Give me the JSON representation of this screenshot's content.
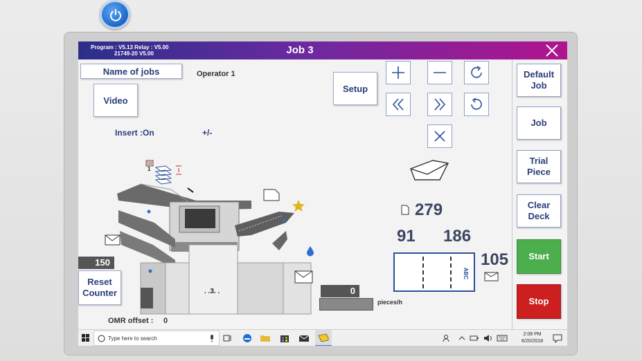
{
  "header": {
    "program_line": "Program : V5.13   Relay : V5.00",
    "serial_line": "21749-20 V5.00",
    "title": "Job 3"
  },
  "controls": {
    "name_of_jobs": "Name of jobs",
    "operator": "Operator 1",
    "video": "Video",
    "setup": "Setup",
    "insert": "Insert :On",
    "plus_minus": "+/-",
    "reset_counter": "Reset Counter",
    "omr_offset_label": "OMR offset :",
    "omr_offset_value": "0",
    "counter_value": "150",
    "machine_dots": ". .3. .",
    "bin_count": "1"
  },
  "stats": {
    "sheets": "279",
    "left_count": "91",
    "right_count": "186",
    "envelope_count": "105",
    "pieces_value": "0",
    "pieces_label": "pieces/h",
    "envelope_text": "ABC"
  },
  "sidebar": {
    "default_job": "Default Job",
    "job": "Job",
    "trial_piece": "Trial Piece",
    "clear_deck": "Clear Deck",
    "start": "Start",
    "stop": "Stop"
  },
  "taskbar": {
    "search_placeholder": "Type here to search",
    "time": "2:08 PM",
    "date": "6/20/2018"
  },
  "colors": {
    "accent": "#2a3d7a",
    "start": "#4cae4c",
    "stop": "#cc1f1f"
  }
}
